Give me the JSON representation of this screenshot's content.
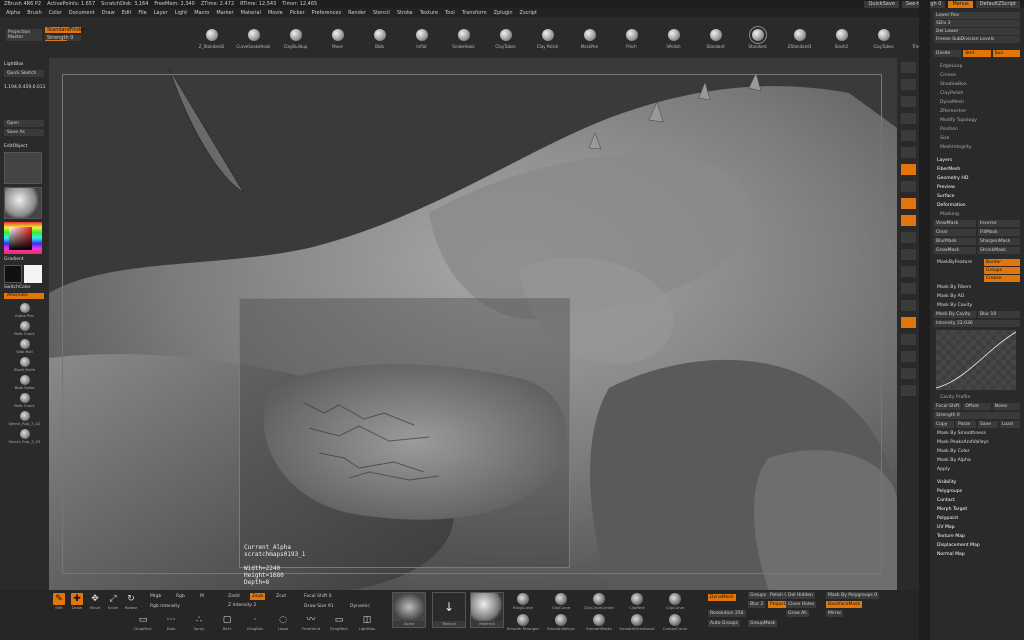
{
  "topbar": {
    "app": "ZBrush 4R6 P2",
    "stats": [
      "ActivePoints: 1.657",
      "ScratchDisk: 3,164",
      "FreeMem: 2,340",
      "ZTime: 2.472",
      "RTime: 12,543",
      "Timer: 12,465"
    ],
    "quicksave": "QuickSave",
    "seethrough": "See-through 0",
    "menus": "Menus",
    "script": "DefaultZScript"
  },
  "menubar": [
    "Alpha",
    "Brush",
    "Color",
    "Document",
    "Draw",
    "Edit",
    "File",
    "Layer",
    "Light",
    "Macro",
    "Marker",
    "Material",
    "Movie",
    "Picker",
    "Preferences",
    "Render",
    "Stencil",
    "Stroke",
    "Texture",
    "Tool",
    "Transform",
    "Zplugin",
    "Zscript"
  ],
  "shelf": {
    "projection": "Projection Master",
    "lightbox": "LightBox",
    "quicksketch": "Quick Sketch",
    "mode": "StandardFinder",
    "strength": "Strength 0",
    "brushes": [
      "Z_Standard2",
      "CurveSnakeHook",
      "ClayBuildup",
      "Move",
      "Blob",
      "Inflat",
      "SnakeHook",
      "ClayTubes",
      "Clay Polish",
      "MaskPen",
      "Pinch",
      "hPolish",
      "Standard",
      "Standard",
      "ZStandard3",
      "Slash2",
      "ClayTubes",
      "TrimDynamic"
    ],
    "selected_brush_index": 13
  },
  "lefttray": {
    "coords": "1.194,0.459,0.011",
    "open": "Open",
    "saveas": "Save As",
    "editobject": "EditObject",
    "gradient": "Gradient",
    "switchcolor": "SwitchColor",
    "alternate": "Alternate",
    "alphas": [
      "Alpha Pen",
      "Blob Crack",
      "Slab Roll",
      "Block Knife",
      "Blob Spike",
      "Blob Crack",
      "Select_Rub_3_02",
      "Select_Rub_3_03"
    ]
  },
  "canvas": {
    "alpha_name": "Current_Alpha",
    "alpha_file": "scratchmaps0193_1",
    "width": "Width=2240",
    "height": "Height=1680",
    "depth": "Depth=8"
  },
  "righttools": [
    "BPR",
    "SPix 3",
    "Scroll",
    "Zoom",
    "Actual",
    "AAHalf",
    "Persp",
    "Floor",
    "Local",
    "LSym",
    "Xyz",
    "Frame",
    "Move",
    "Scale",
    "Rotate",
    "PolyF",
    "Transp",
    "Ghost",
    "Solo",
    "Xpose"
  ],
  "rightpanel": {
    "top": [
      {
        "label": "Lower Res",
        "type": "btn"
      },
      {
        "label": "SDiv 3",
        "type": "slider"
      },
      {
        "label": "Del Lower",
        "type": "btn"
      },
      {
        "label": "Freeze SubDivision Levels",
        "type": "btn"
      }
    ],
    "divide": "Divide",
    "smt": "Smt",
    "suv": "Suv",
    "submenus": [
      "EdgeLoop",
      "Crease",
      "ShadowBox",
      "ClayPolish",
      "DynaMesh",
      "ZRemesher",
      "Modify Topology",
      "Position",
      "Size",
      "MeshIntegrity"
    ],
    "sections": [
      "Layers",
      "FiberMesh",
      "Geometry HD",
      "Preview",
      "Surface",
      "Deformation"
    ],
    "masking_title": "Masking",
    "masking_grid": [
      [
        "ViewMask",
        "Inverse"
      ],
      [
        "Clear",
        "FillMask"
      ],
      [
        "BlurMask",
        "SharpenMask"
      ],
      [
        "GrowMask",
        "ShrinkMask"
      ]
    ],
    "mask_by_feature": "MaskByFeature",
    "border": "Border",
    "groups": "Groups",
    "crease": "Crease",
    "mask_lines": [
      "Mask By Fibers",
      "Mask By AO",
      "Mask By Cavity"
    ],
    "mask_by_cavity_btn": "Mask By Cavity",
    "blur": "Blur 10",
    "intensity": "Intensity 22.036",
    "cavity_profile": "Cavity Profile",
    "focal_shift": "Focal Shift -28",
    "offset": "Offset",
    "noise": "Noise",
    "strength": "Strength 0",
    "copy": "Copy",
    "paste": "Paste",
    "save": "Save",
    "load": "Load",
    "mask_lines2": [
      "Mask By Smoothness",
      "Mask PeaksAndValleys",
      "Mask By Color",
      "Mask By Alpha"
    ],
    "apply": "Apply",
    "bottom_sections": [
      "Visibility",
      "Polygroups",
      "Contact",
      "Morph Target",
      "Polypaint",
      "UV Map",
      "Texture Map",
      "Displacement Map",
      "Normal Map"
    ]
  },
  "bottombar": {
    "tools": [
      "Edit",
      "Draw",
      "Move",
      "Scale",
      "Rotate"
    ],
    "mrgb": "Mrgb",
    "rgb": "Rgb",
    "m": "M",
    "zadd": "Zadd",
    "zsub": "Zsub",
    "zcut": "Zcut",
    "rgb_intensity": "Rgb Intensity",
    "z_intensity": "Z Intensity 2",
    "focal_shift": "Focal Shift 0",
    "draw_size": "Draw Size 91",
    "dynamic": "Dynamic",
    "strokes": [
      "DragRect",
      "Dots",
      "Spray",
      "Rect",
      "DragDot",
      "Lasso",
      "FreeHand",
      "DragRect",
      "LightBox"
    ],
    "slot_labels": [
      "Alpha",
      "Texture",
      "Material"
    ],
    "alpha_presets": [
      "RingCurve",
      "ClipCurve",
      "ClipCircleCenter",
      "ClipRect",
      "ClipCurve"
    ],
    "alpha_presets2": [
      "Smooth Stronger",
      "SmoothValleys",
      "SmoothPeaks",
      "SmoothDirectional",
      "CreaseCurve"
    ],
    "dynamesh": "DynaMesh",
    "groups": "Groups",
    "polish": "Polish 0",
    "blur": "Blur 2",
    "project": "Project",
    "resolution": "Resolution 256",
    "auto_groups": "Auto Groups",
    "group_mask": "GroupMask",
    "del_hidden": "Del Hidden",
    "close_holes": "Close Holes",
    "grow_all": "Grow All",
    "mask_by_polygroups": "Mask By Polygroups 0",
    "backface_mask": "BackfaceMask",
    "mirror": "Mirror"
  },
  "colors": {
    "accent": "#e2760b",
    "panel": "#2a2a2a",
    "canvas": "#3a3a3a"
  }
}
